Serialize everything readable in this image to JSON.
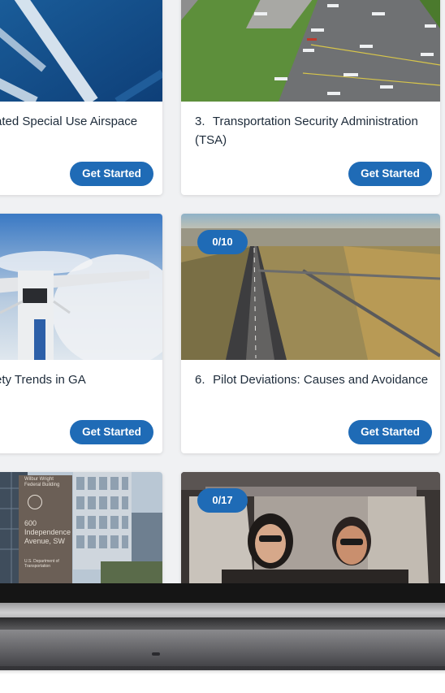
{
  "cards": [
    {
      "title": "ated Special Use Airspace",
      "button": "Get Started"
    },
    {
      "number": "3.",
      "title": "Transportation Security Administration (TSA)",
      "button": "Get Started"
    },
    {
      "title": "ety Trends in GA",
      "button": "Get Started"
    },
    {
      "number": "6.",
      "title": "Pilot Deviations: Causes and Avoidance",
      "badge": "0/10",
      "button": "Get Started"
    },
    {
      "badge": "0/17"
    }
  ],
  "building_sign": {
    "line1": "Wilbur Wright",
    "line2": "Federal Building",
    "address1": "600",
    "address2": "Independence",
    "address3": "Avenue, SW",
    "footer1": "U.S. Department of",
    "footer2": "Transportation"
  },
  "colors": {
    "accent": "#1f6bb6",
    "background": "#f0f1f3"
  }
}
